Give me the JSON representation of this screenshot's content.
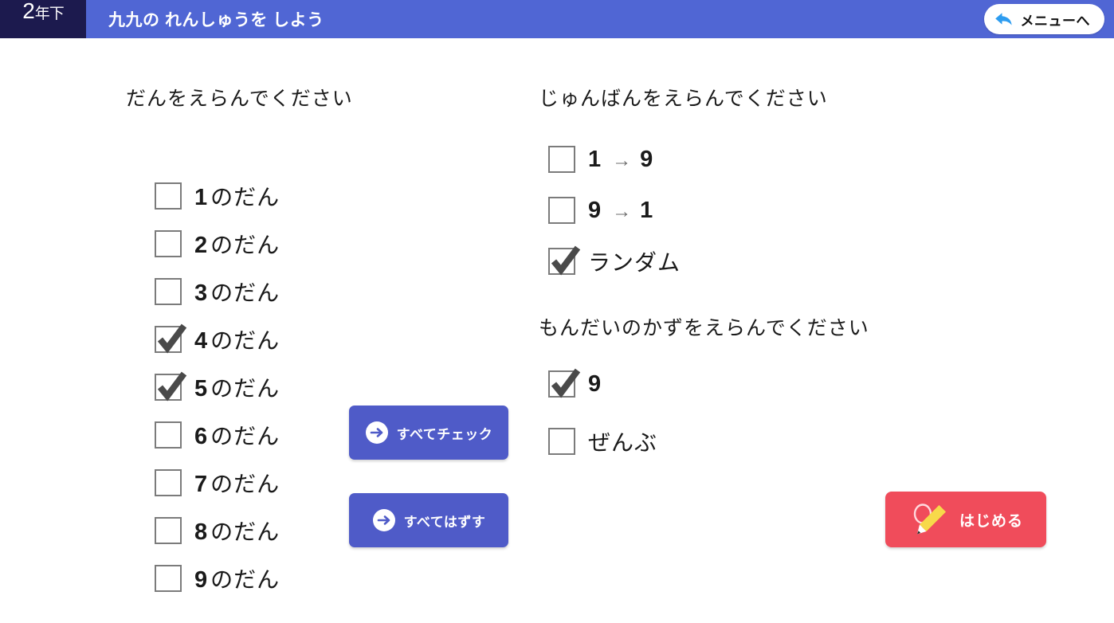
{
  "header": {
    "grade_number": "2",
    "grade_suffix": "年下",
    "title": "九九の れんしゅうを しよう",
    "menu_button_label": "メニューへ",
    "back_arrow_icon": "back-arrow-icon",
    "bar_color": "#5066d4",
    "badge_color": "#1c1a4e"
  },
  "left_panel": {
    "title": "だんをえらんでください",
    "items": [
      {
        "num": "1",
        "suffix": "のだん",
        "checked": false
      },
      {
        "num": "2",
        "suffix": "のだん",
        "checked": false
      },
      {
        "num": "3",
        "suffix": "のだん",
        "checked": false
      },
      {
        "num": "4",
        "suffix": "のだん",
        "checked": true
      },
      {
        "num": "5",
        "suffix": "のだん",
        "checked": true
      },
      {
        "num": "6",
        "suffix": "のだん",
        "checked": false
      },
      {
        "num": "7",
        "suffix": "のだん",
        "checked": false
      },
      {
        "num": "8",
        "suffix": "のだん",
        "checked": false
      },
      {
        "num": "9",
        "suffix": "のだん",
        "checked": false
      }
    ]
  },
  "order_section": {
    "title": "じゅんばんをえらんでください",
    "items": [
      {
        "from": "1",
        "arrow": "→",
        "to": "9",
        "checked": false
      },
      {
        "from": "9",
        "arrow": "→",
        "to": "1",
        "checked": false
      },
      {
        "label": "ランダム",
        "checked": true
      }
    ]
  },
  "count_section": {
    "title": "もんだいのかずをえらんでください",
    "items": [
      {
        "label": "9",
        "checked": true
      },
      {
        "label": "ぜんぶ",
        "checked": false
      }
    ]
  },
  "buttons": {
    "check_all": {
      "label": "すべてチェック",
      "icon": "arrow-circle-right-icon",
      "color": "#4f5bc8"
    },
    "uncheck_all": {
      "label": "すべてはずす",
      "icon": "arrow-circle-right-icon",
      "color": "#4f5bc8"
    },
    "start": {
      "label": "はじめる",
      "icon": "pencil-icon",
      "color": "#f04c5b"
    }
  }
}
